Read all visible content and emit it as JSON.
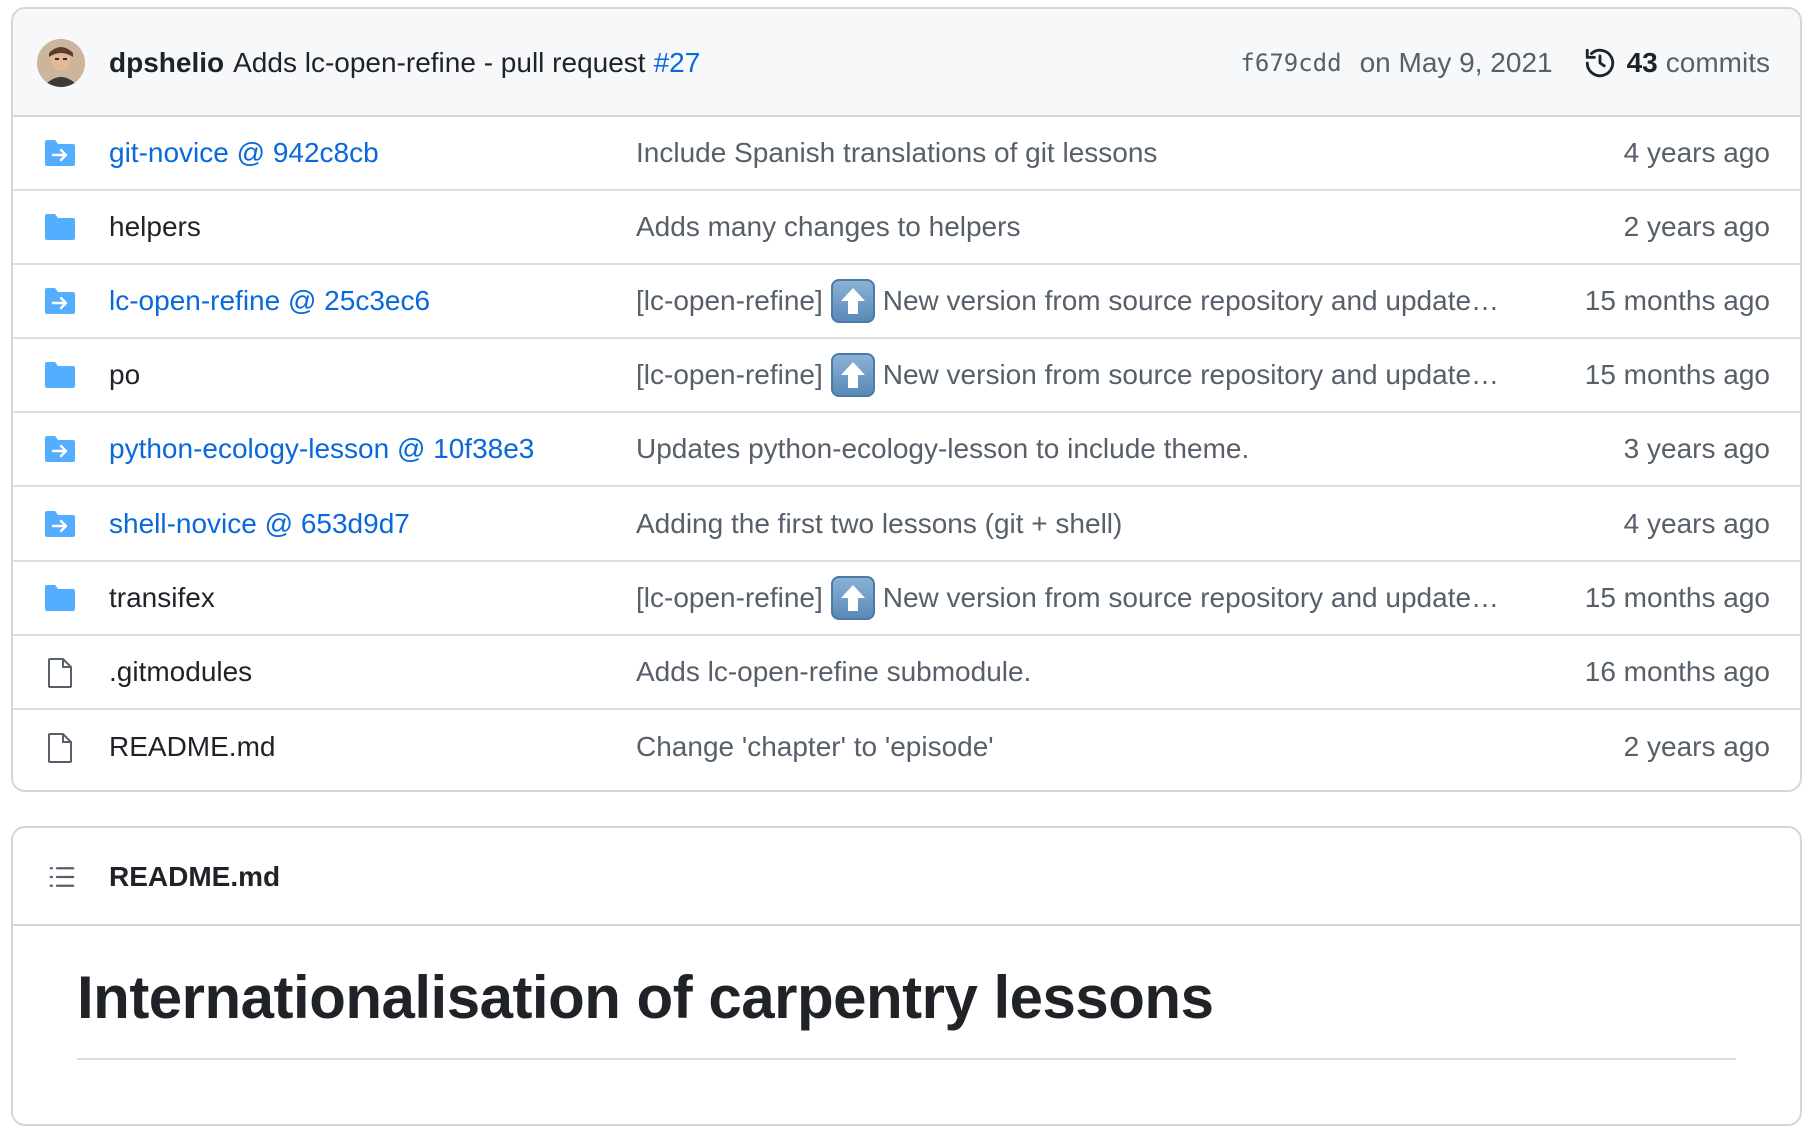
{
  "commit": {
    "author": "dpshelio",
    "message": "Adds lc-open-refine - pull request",
    "pr": "#27",
    "sha": "f679cdd",
    "date": "on May 9, 2021",
    "count": "43",
    "count_label": "commits"
  },
  "files": [
    {
      "type": "submodule",
      "name": "git-novice @ 942c8cb",
      "message": "Include Spanish translations of git lessons",
      "age": "4 years ago"
    },
    {
      "type": "folder",
      "name": "helpers",
      "message": "Adds many changes to helpers",
      "age": "2 years ago"
    },
    {
      "type": "submodule",
      "name": "lc-open-refine @ 25c3ec6",
      "message_prefix": "[lc-open-refine]",
      "message_emoji": "arrow-up-emoji",
      "message_suffix": "New version from source repository and update…",
      "age": "15 months ago"
    },
    {
      "type": "folder",
      "name": "po",
      "message_prefix": "[lc-open-refine]",
      "message_emoji": "arrow-up-emoji",
      "message_suffix": "New version from source repository and update…",
      "age": "15 months ago"
    },
    {
      "type": "submodule",
      "name": "python-ecology-lesson @ 10f38e3",
      "message": "Updates python-ecology-lesson to include theme.",
      "age": "3 years ago"
    },
    {
      "type": "submodule",
      "name": "shell-novice @ 653d9d7",
      "message": "Adding the first two lessons (git + shell)",
      "age": "4 years ago"
    },
    {
      "type": "folder",
      "name": "transifex",
      "message_prefix": "[lc-open-refine]",
      "message_emoji": "arrow-up-emoji",
      "message_suffix": "New version from source repository and update…",
      "age": "15 months ago"
    },
    {
      "type": "file",
      "name": ".gitmodules",
      "message": "Adds lc-open-refine submodule.",
      "age": "16 months ago"
    },
    {
      "type": "file",
      "name": "README.md",
      "message": "Change 'chapter' to 'episode'",
      "age": "2 years ago"
    }
  ],
  "readme": {
    "filename": "README.md",
    "heading": "Internationalisation of carpentry lessons"
  },
  "colors": {
    "link": "#0969da",
    "folder": "#54aeff",
    "muted": "#57606a",
    "border": "#d0d7de"
  }
}
